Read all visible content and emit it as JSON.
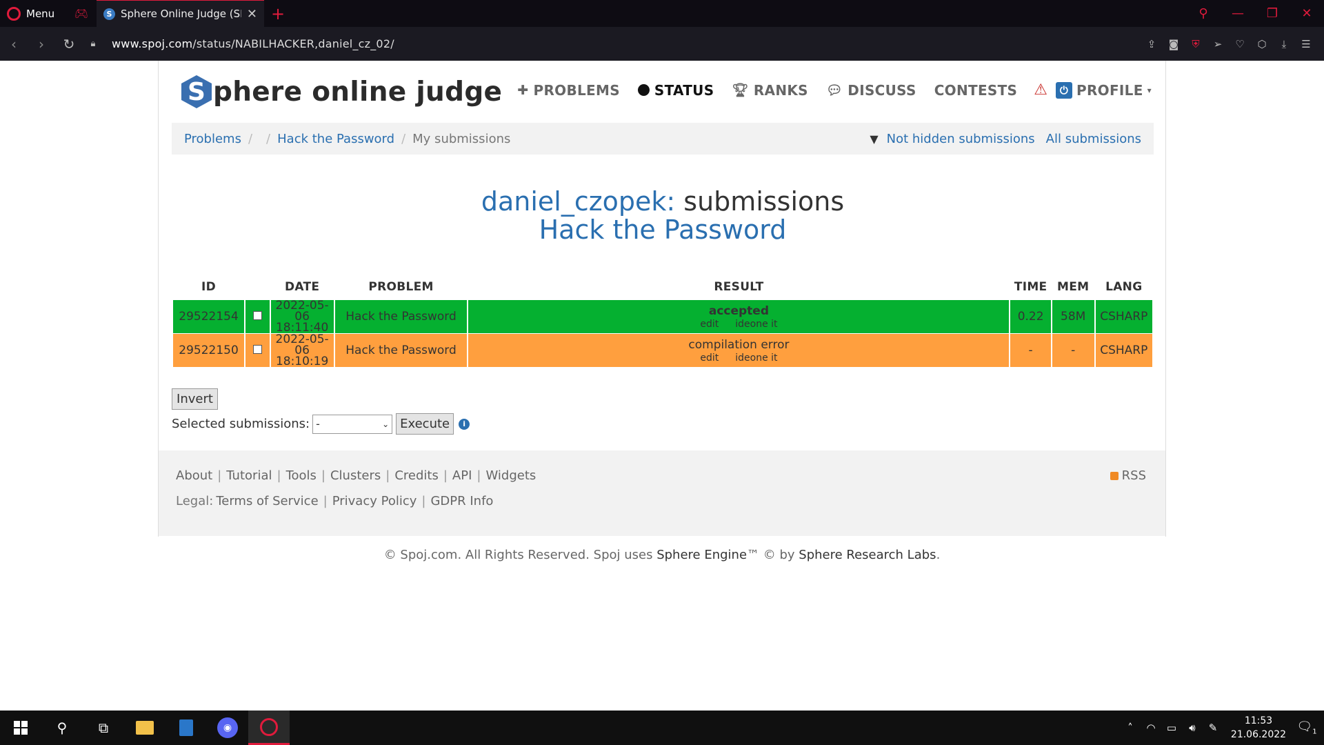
{
  "browser": {
    "menu_label": "Menu",
    "tab_title": "Sphere Online Judge (SPOJ",
    "tab_favicon_letter": "S",
    "url_domain": "www.spoj.com",
    "url_path": "/status/NABILHACKER,daniel_cz_02/"
  },
  "site": {
    "logo_letter": "S",
    "logo_text": "phere online judge",
    "nav": {
      "problems": "PROBLEMS",
      "status": "STATUS",
      "ranks": "RANKS",
      "discuss": "DISCUSS",
      "contests": "CONTESTS",
      "profile": "PROFILE"
    }
  },
  "breadcrumb": {
    "problems": "Problems",
    "problem": "Hack the Password",
    "current": "My submissions",
    "not_hidden": "Not hidden submissions",
    "all": "All submissions"
  },
  "heading": {
    "user": "daniel_czopek:",
    "suffix": " submissions",
    "problem": "Hack the Password"
  },
  "table": {
    "headers": [
      "ID",
      "DATE",
      "PROBLEM",
      "RESULT",
      "TIME",
      "MEM",
      "LANG"
    ],
    "rows": [
      {
        "id": "29522154",
        "date": "2022-05-06",
        "time_of_day": "18:11:40",
        "problem": "Hack the Password",
        "result": "accepted",
        "link_edit": "edit",
        "link_ideone": "ideone it",
        "time": "0.22",
        "mem": "58M",
        "lang": "CSHARP",
        "status_color": "#05b030"
      },
      {
        "id": "29522150",
        "date": "2022-05-06",
        "time_of_day": "18:10:19",
        "problem": "Hack the Password",
        "result": "compilation error",
        "link_edit": "edit",
        "link_ideone": "ideone it",
        "time": "-",
        "mem": "-",
        "lang": "CSHARP",
        "status_color": "#ff9f3e"
      }
    ]
  },
  "controls": {
    "invert": "Invert",
    "selected_label": "Selected submissions:",
    "select_value": "-",
    "execute": "Execute"
  },
  "footer": {
    "links": [
      "About",
      "Tutorial",
      "Tools",
      "Clusters",
      "Credits",
      "API",
      "Widgets"
    ],
    "legal_label": "Legal:",
    "legal_links": [
      "Terms of Service",
      "Privacy Policy",
      "GDPR Info"
    ],
    "rss": "RSS",
    "copyright_prefix": "© Spoj.com. All Rights Reserved. Spoj uses ",
    "engine": "Sphere Engine",
    "copyright_mid": "™ © by ",
    "labs": "Sphere Research Labs",
    "copyright_end": "."
  },
  "taskbar": {
    "time": "11:53",
    "date": "21.06.2022",
    "notification_count": "1"
  }
}
